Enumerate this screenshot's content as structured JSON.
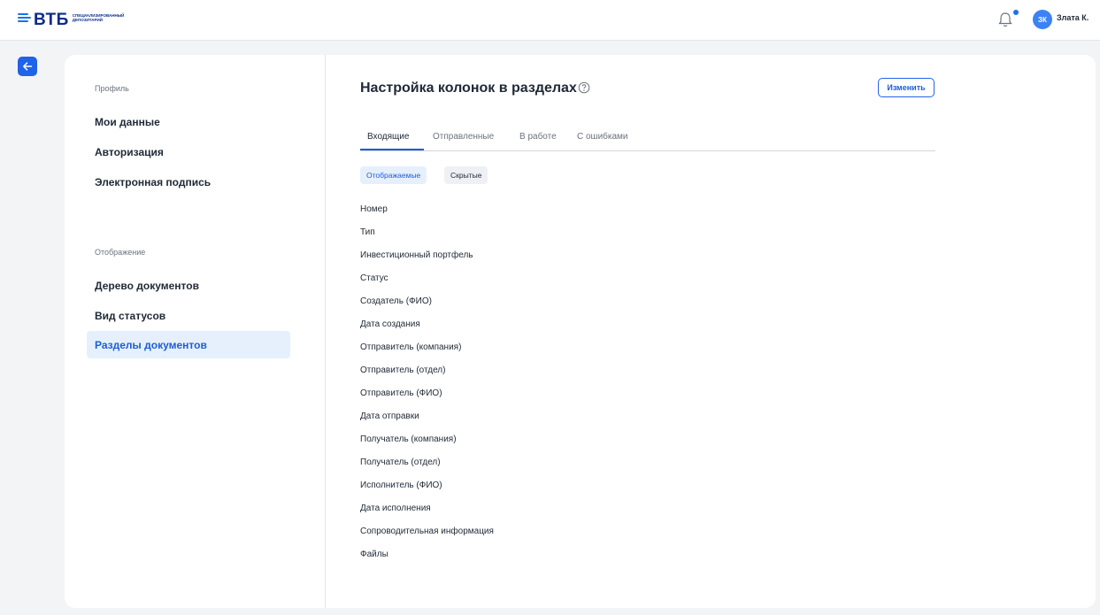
{
  "header": {
    "logo_text": "ВТБ",
    "logo_subtitle_line1": "СПЕЦИАЛИЗИРОВАННЫЙ",
    "logo_subtitle_line2": "ДЕПОЗИТАРИЙ",
    "avatar_initials": "ЗК",
    "user_name": "Злата К.",
    "icons": [
      "bell-icon",
      "back-arrow-icon",
      "help-icon"
    ]
  },
  "sidebar": {
    "profile_label": "Профиль",
    "profile_items": [
      {
        "label": "Мои данные"
      },
      {
        "label": "Авторизация"
      },
      {
        "label": "Электронная подпись"
      }
    ],
    "display_label": "Отображение",
    "display_items": [
      {
        "label": "Дерево документов"
      },
      {
        "label": "Вид статусов"
      },
      {
        "label": "Разделы документов",
        "active": true
      }
    ]
  },
  "main": {
    "title": "Настройка колонок в разделах",
    "edit_label": "Изменить",
    "tabs": [
      {
        "label": "Входящие",
        "active": true
      },
      {
        "label": "Отправленные"
      },
      {
        "label": "В работе"
      },
      {
        "label": "С ошибками"
      }
    ],
    "filters": [
      {
        "label": "Отображаемые",
        "active": true
      },
      {
        "label": "Скрытые"
      }
    ],
    "columns": [
      "Номер",
      "Тип",
      "Инвестиционный портфель",
      "Статус",
      "Создатель (ФИО)",
      "Дата создания",
      "Отправитель (компания)",
      "Отправитель (отдел)",
      "Отправитель (ФИО)",
      "Дата отправки",
      "Получатель (компания)",
      "Получатель (отдел)",
      "Исполнитель (ФИО)",
      "Дата исполнения",
      "Сопроводительная информация",
      "Файлы"
    ]
  },
  "colors": {
    "accent": "#1a5fd7",
    "brand": "#0b2c8a",
    "active_bg": "#e6f0fd"
  }
}
